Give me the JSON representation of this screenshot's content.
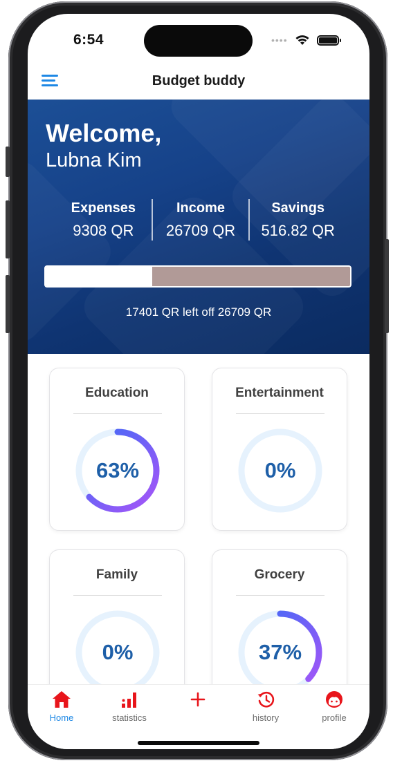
{
  "status_bar": {
    "time": "6:54",
    "wifi_icon": "wifi-icon",
    "battery_icon": "battery-icon"
  },
  "app_bar": {
    "title": "Budget buddy",
    "menu_icon": "hamburger-menu-icon"
  },
  "hero": {
    "greeting": "Welcome,",
    "user_name": "Lubna Kim",
    "stats": [
      {
        "label": "Expenses",
        "value": "9308 QR"
      },
      {
        "label": "Income",
        "value": "26709 QR"
      },
      {
        "label": "Savings",
        "value": "516.82 QR"
      }
    ],
    "budget_used_fraction": 0.35,
    "remaining_text": "17401 QR left off 26709 QR"
  },
  "categories": [
    {
      "name": "Education",
      "percent_label": "63%",
      "percent": 63
    },
    {
      "name": "Entertainment",
      "percent_label": "0%",
      "percent": 0
    },
    {
      "name": "Family",
      "percent_label": "0%",
      "percent": 0
    },
    {
      "name": "Grocery",
      "percent_label": "37%",
      "percent": 37
    }
  ],
  "colors": {
    "accent": "#1e88e5",
    "nav_active_icon": "#e8151b",
    "ring_track": "#e6f2fd",
    "ring_start": "#a855f7",
    "ring_end": "#3b6cf6",
    "hero_bg": "#164289"
  },
  "bottom_nav": [
    {
      "label": "Home",
      "icon": "home-icon",
      "active": true
    },
    {
      "label": "statistics",
      "icon": "bar-chart-icon",
      "active": false
    },
    {
      "label": "",
      "icon": "plus-icon",
      "active": false
    },
    {
      "label": "history",
      "icon": "history-icon",
      "active": false
    },
    {
      "label": "profile",
      "icon": "profile-icon",
      "active": false
    }
  ]
}
